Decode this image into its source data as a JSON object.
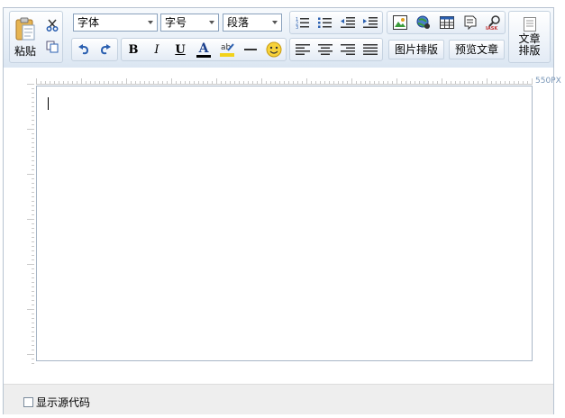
{
  "toolbar": {
    "paste_label": "粘贴",
    "font_family": {
      "value": "字体",
      "options": [
        "字体"
      ]
    },
    "font_size": {
      "value": "字号",
      "options": [
        "字号"
      ]
    },
    "paragraph": {
      "value": "段落",
      "options": [
        "段落"
      ]
    },
    "image_layout_label": "图片排版",
    "preview_label": "预览文章",
    "article_layout_label_line1": "文章",
    "article_layout_label_line2": "排版",
    "icons": [
      "cut-icon",
      "copy-icon",
      "undo-icon",
      "redo-icon",
      "bold-icon",
      "italic-icon",
      "underline-icon",
      "font-color-icon",
      "highlight-icon",
      "horizontal-rule-icon",
      "emoticon-icon",
      "ordered-list-icon",
      "unordered-list-icon",
      "outdent-icon",
      "indent-icon",
      "align-left-icon",
      "align-center-icon",
      "align-right-icon",
      "align-justify-icon",
      "insert-image-icon",
      "insert-link-icon",
      "insert-table-icon",
      "insert-page-icon",
      "find-replace-icon"
    ],
    "colors": {
      "accent": "#2a5fb0",
      "toolbar_bg": "#dbe6f2",
      "border": "#b7c3d1"
    }
  },
  "editor": {
    "width_label": "550PX",
    "content": ""
  },
  "footer": {
    "show_source_label": "显示源代码",
    "show_source_checked": false
  }
}
